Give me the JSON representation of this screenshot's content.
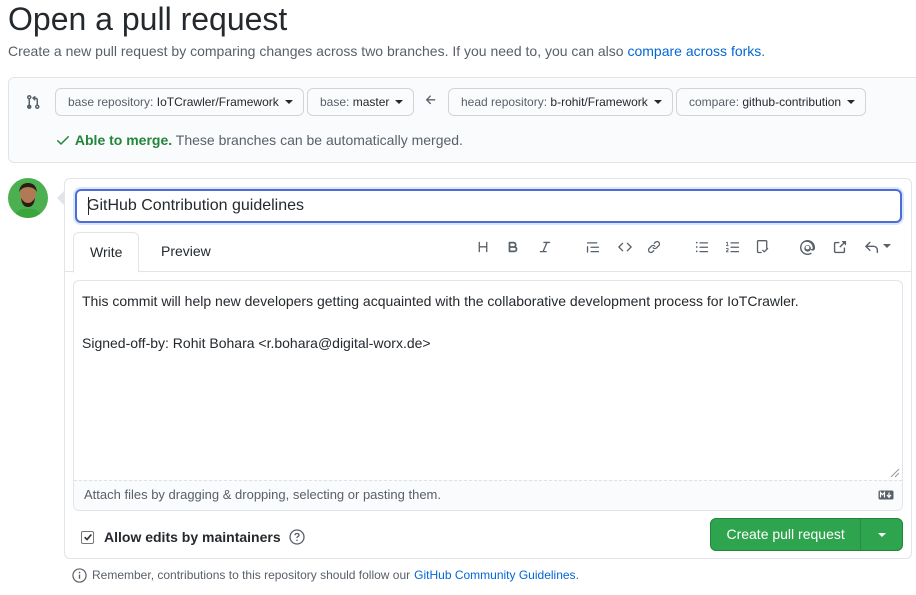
{
  "page": {
    "title": "Open a pull request",
    "subtitle_text": "Create a new pull request by comparing changes across two branches. If you need to, you can also",
    "subtitle_link": "compare across forks",
    "subtitle_end": "."
  },
  "range": {
    "base_repo_label": "base repository:",
    "base_repo_value": "IoTCrawler/Framework",
    "base_label": "base:",
    "base_value": "master",
    "head_repo_label": "head repository:",
    "head_repo_value": "b-rohit/Framework",
    "compare_label": "compare:",
    "compare_value": "github-contribution",
    "merge_ok": "Able to merge.",
    "merge_text": "These branches can be automatically merged."
  },
  "form": {
    "title_value": "GitHub Contribution guidelines",
    "tabs": [
      "Write",
      "Preview"
    ],
    "toolbar_icons": [
      "heading-icon",
      "bold-icon",
      "italic-icon",
      "quote-icon",
      "code-icon",
      "link-icon",
      "unordered-list-icon",
      "ordered-list-icon",
      "task-list-icon",
      "mention-icon",
      "reference-icon",
      "reply-icon"
    ],
    "body_line1": "This commit will help new developers getting acquainted with the collaborative development process for IoTCrawler.",
    "body_line2": "Signed-off-by: Rohit Bohara <r.bohara@digital-worx.de>",
    "attach_text": "Attach files by dragging & dropping, selecting or pasting them.",
    "allow_edits_label": "Allow edits by maintainers",
    "allow_edits_checked": true,
    "create_button": "Create pull request"
  },
  "footer": {
    "text": "Remember, contributions to this repository should follow our",
    "link": "GitHub Community Guidelines",
    "end": "."
  },
  "colors": {
    "accent_blue": "#0366d6",
    "success_green": "#2ea44f",
    "merge_green": "#22863a"
  }
}
